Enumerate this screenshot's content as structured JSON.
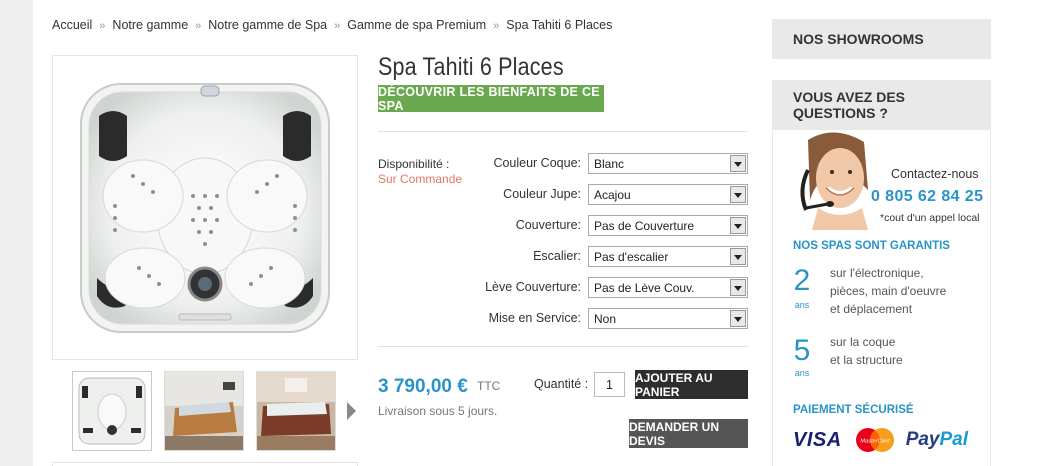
{
  "breadcrumb": {
    "items": [
      "Accueil",
      "Notre gamme",
      "Notre gamme de Spa",
      "Gamme de spa Premium",
      "Spa Tahiti 6 Places"
    ],
    "separator": "»"
  },
  "product": {
    "title": "Spa Tahiti 6 Places",
    "discover_label": "DÉCOUVRIR LES BIENFAITS DE CE SPA",
    "availability_label": "Disponibilité :",
    "availability_value": "Sur Commande",
    "options": [
      {
        "label": "Couleur Coque:",
        "value": "Blanc"
      },
      {
        "label": "Couleur Jupe:",
        "value": "Acajou"
      },
      {
        "label": "Couverture:",
        "value": "Pas de Couverture"
      },
      {
        "label": "Escalier:",
        "value": "Pas d'escalier"
      },
      {
        "label": "Lève Couverture:",
        "value": "Pas de Lève Couv."
      },
      {
        "label": "Mise en Service:",
        "value": "Non"
      }
    ],
    "price": "3 790,00 €",
    "price_suffix": "TTC",
    "delivery": "Livraison sous 5 jours.",
    "quantity_label": "Quantité :",
    "quantity_value": "1",
    "add_to_cart_label": "AJOUTER AU PANIER",
    "quote_label": "DEMANDER UN DEVIS"
  },
  "sidebar": {
    "showrooms_title": "NOS SHOWROOMS",
    "questions_title": "VOUS AVEZ DES QUESTIONS ?",
    "contact_label": "Contactez-nous",
    "phone": "0 805 62 84 25",
    "phone_note": "*cout d'un appel local",
    "guarantee_title": "NOS SPAS SONT GARANTIS",
    "guarantees": [
      {
        "years": "2",
        "unit": "ans",
        "lines": [
          "sur l'électronique,",
          "pièces, main d'oeuvre",
          "et déplacement"
        ]
      },
      {
        "years": "5",
        "unit": "ans",
        "lines": [
          "sur la coque",
          "et la structure"
        ]
      }
    ],
    "payment_title": "PAIEMENT SÉCURISÉ",
    "payment_logos": {
      "visa": "VISA",
      "mastercard": "MasterCard",
      "paypal_a": "Pay",
      "paypal_b": "Pal"
    }
  },
  "colors": {
    "accent_blue": "#2a94c8",
    "green": "#6aa94f",
    "dark_button": "#2d2d2d",
    "availability": "#e07a63"
  }
}
